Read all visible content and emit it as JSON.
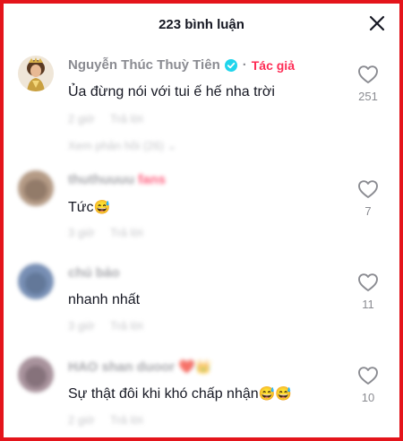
{
  "header": {
    "title": "223 bình luận",
    "close_icon": "close-icon"
  },
  "colors": {
    "border": "#e4141b",
    "author_tag": "#fe2c55",
    "verified": "#20d5ec",
    "text": "#161823",
    "muted": "#8a8b91"
  },
  "comments": [
    {
      "username": "Nguyễn Thúc Thuỳ Tiên",
      "verified": true,
      "author_tag": "Tác giả",
      "text": "Ủa đừng nói với tui ế hế nha trời",
      "meta_time": "2 giờ",
      "meta_reply": "Trả lời",
      "view_replies": "Xem phản hồi (26) ⌄",
      "likes": "251"
    },
    {
      "username": "thuthuuuu",
      "blurred_suffix": "fans",
      "text": "Tức",
      "emoji": "😅",
      "meta_time": "3 giờ",
      "meta_reply": "Trả lời",
      "likes": "7"
    },
    {
      "username": "chú bảo",
      "text": "nhanh nhất",
      "meta_time": "3 giờ",
      "meta_reply": "Trả lời",
      "likes": "11"
    },
    {
      "username": "HAO shan duoor",
      "text": "Sự thật đôi khi khó chấp nhận",
      "emoji": "😅😅",
      "meta_time": "2 giờ",
      "meta_reply": "Trả lời",
      "likes": "10"
    }
  ]
}
